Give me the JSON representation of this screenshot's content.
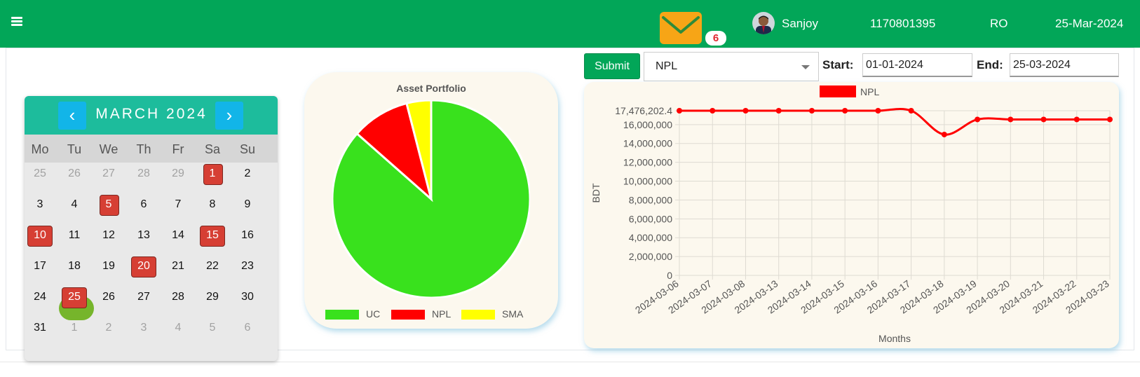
{
  "header": {
    "menu_icon": "hamburger-menu-icon",
    "mail_icon": "envelope-icon",
    "mail_badge": "6",
    "user_name": "Sanjoy",
    "user_id": "1170801395",
    "role": "RO",
    "date": "25-Mar-2024",
    "brand_color": "#02a658"
  },
  "calendar": {
    "month_label": "MARCH 2024",
    "prev_label": "‹",
    "next_label": "›",
    "weekdays": [
      "Mo",
      "Tu",
      "We",
      "Th",
      "Fr",
      "Sa",
      "Su"
    ],
    "weeks": [
      [
        "25",
        "26",
        "27",
        "28",
        "29",
        "1",
        "2"
      ],
      [
        "3",
        "4",
        "5",
        "6",
        "7",
        "8",
        "9"
      ],
      [
        "10",
        "11",
        "12",
        "13",
        "14",
        "15",
        "16"
      ],
      [
        "17",
        "18",
        "19",
        "20",
        "21",
        "22",
        "23"
      ],
      [
        "24",
        "25",
        "26",
        "27",
        "28",
        "29",
        "30"
      ],
      [
        "31",
        "1",
        "2",
        "3",
        "4",
        "5",
        "6"
      ]
    ],
    "highlighted_days": [
      "1",
      "5",
      "10",
      "15",
      "20",
      "25"
    ],
    "today": "25",
    "header_color": "#1dbc9c",
    "highlight_color": "#d63f34"
  },
  "filter": {
    "submit_label": "Submit",
    "select_value": "NPL",
    "start_label": "Start:",
    "start_value": "01-01-2024",
    "end_label": "End:",
    "end_value": "25-03-2024"
  },
  "chart_data": [
    {
      "type": "pie",
      "title": "Asset Portfolio",
      "labels": [
        "UC",
        "NPL",
        "SMA"
      ],
      "values": [
        86.5,
        9.5,
        4.0
      ],
      "colors": [
        "#39e11d",
        "#ff0000",
        "#ffff00"
      ],
      "legend": "bottom"
    },
    {
      "type": "line",
      "title": "",
      "xlabel": "Months",
      "ylabel": "BDT",
      "x": [
        "2024-03-06",
        "2024-03-07",
        "2024-03-08",
        "2024-03-13",
        "2024-03-14",
        "2024-03-15",
        "2024-03-16",
        "2024-03-17",
        "2024-03-18",
        "2024-03-19",
        "2024-03-20",
        "2024-03-21",
        "2024-03-22",
        "2024-03-23"
      ],
      "series": [
        {
          "name": "NPL",
          "color": "#ff0000",
          "values": [
            17476202.4,
            17476202.4,
            17476202.4,
            17476202.4,
            17476202.4,
            17476202.4,
            17476202.4,
            17476202.4,
            14950000,
            16550000,
            16550000,
            16550000,
            16550000,
            16550000
          ]
        }
      ],
      "ylim": [
        0,
        17476202.4
      ],
      "yticks": [
        "0",
        "2,000,000",
        "4,000,000",
        "6,000,000",
        "8,000,000",
        "10,000,000",
        "12,000,000",
        "14,000,000",
        "16,000,000",
        "17,476,202.4"
      ],
      "grid": true,
      "legend": "top"
    }
  ]
}
